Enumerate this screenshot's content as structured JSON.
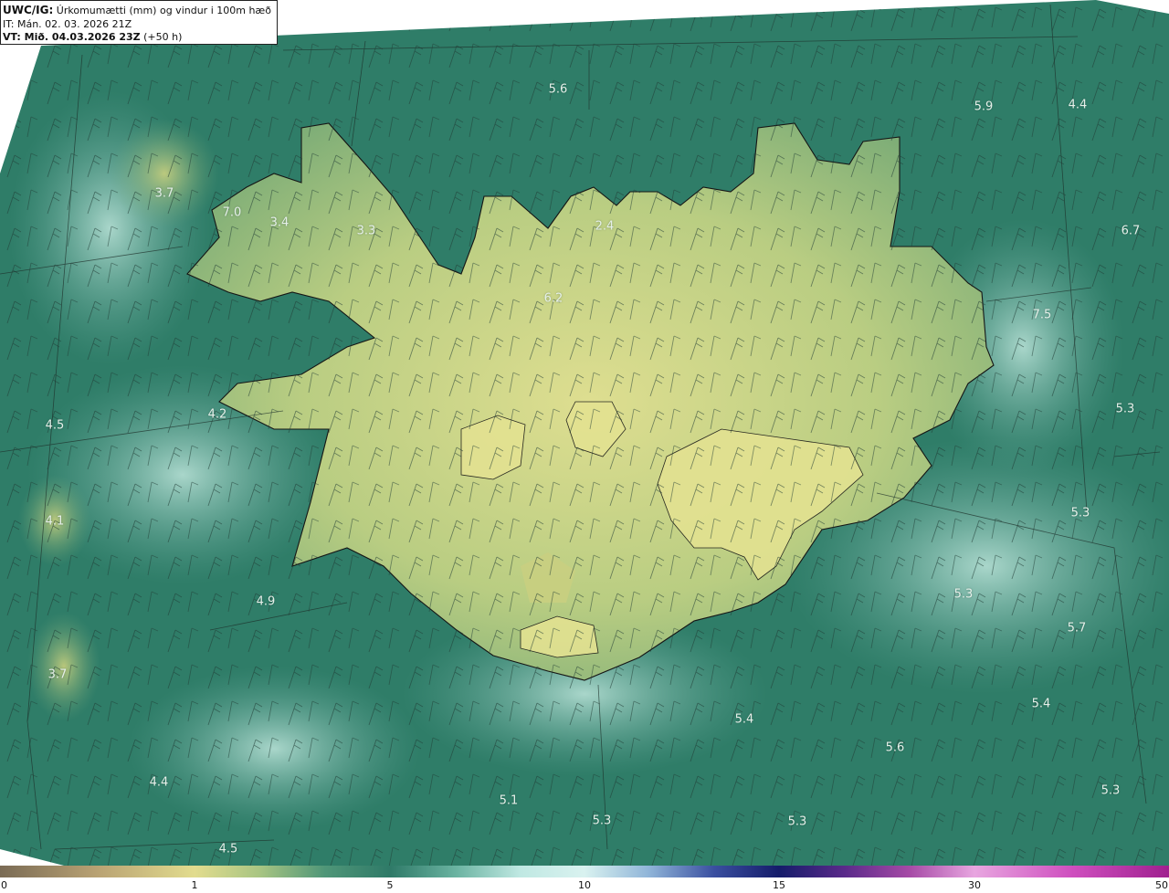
{
  "header": {
    "model_label": "UWC/IG:",
    "title": "Úrkomumætti (mm) og vindur i 100m hæð",
    "issue_time": "IT: Mán. 02. 03. 2026 21Z",
    "valid_label": "VT: Mið. 04.03.2026 23Z",
    "lead": "(+50 h)"
  },
  "colorbar": {
    "ticks": [
      "0",
      "1",
      "5",
      "10",
      "15",
      "30",
      "50"
    ]
  },
  "map_values": [
    "5.6",
    "5.9",
    "4.4",
    "3.7",
    "7.0",
    "3.4",
    "3.3",
    "2.4",
    "6.7",
    "6.2",
    "7.5",
    "4.5",
    "4.2",
    "5.3",
    "4.1",
    "5.3",
    "4.9",
    "5.3",
    "5.7",
    "3.7",
    "5.4",
    "5.4",
    "5.6",
    "4.4",
    "5.1",
    "5.3",
    "5.3",
    "5.3",
    "4.5"
  ],
  "palette": {
    "sea": "#2f7d68",
    "land_low": "#d6dc8b",
    "land_mid": "#a9c27a",
    "coast": "#1a1a1a"
  }
}
